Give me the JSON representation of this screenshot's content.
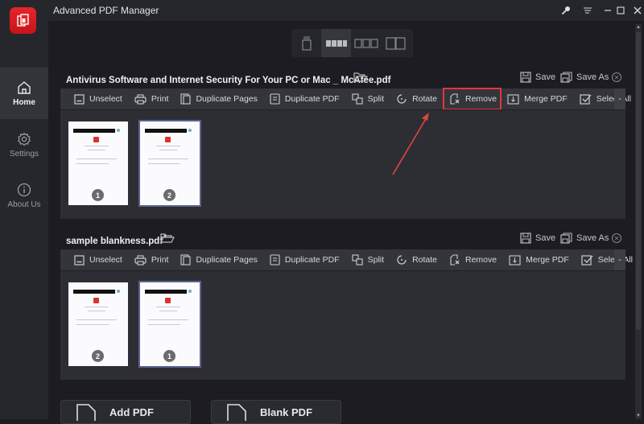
{
  "app": {
    "title": "Advanced PDF Manager",
    "accent_color": "#e5252a",
    "highlight_color": "#e5353a"
  },
  "window_controls": [
    {
      "name": "key-icon",
      "label": "Register"
    },
    {
      "name": "menu-icon",
      "label": "Menu"
    },
    {
      "name": "minimize-icon",
      "label": "Minimize"
    },
    {
      "name": "maximize-icon",
      "label": "Maximize"
    },
    {
      "name": "close-icon",
      "label": "Close"
    }
  ],
  "sidebar": {
    "items": [
      {
        "label": "Home",
        "icon": "home-icon",
        "active": true
      },
      {
        "label": "Settings",
        "icon": "gear-icon",
        "active": false
      },
      {
        "label": "About Us",
        "icon": "info-icon",
        "active": false
      }
    ]
  },
  "view_modes": [
    {
      "name": "single-page-view",
      "active": false
    },
    {
      "name": "four-column-view",
      "active": true
    },
    {
      "name": "three-column-view",
      "active": false
    },
    {
      "name": "two-column-view",
      "active": false
    }
  ],
  "header_actions": {
    "save": "Save",
    "save_as": "Save As"
  },
  "toolbar": {
    "unselect": "Unselect",
    "print": "Print",
    "duplicate_pages": "Duplicate Pages",
    "duplicate_pdf": "Duplicate PDF",
    "split": "Split",
    "rotate": "Rotate",
    "remove": "Remove",
    "merge_pdf": "Merge PDF",
    "select_all": "Select All",
    "more": "-"
  },
  "documents": [
    {
      "name": "Antivirus Software and Internet Security For Your PC or Mac _ McAfee.pdf",
      "modified_marker": "",
      "pages": [
        {
          "number": "1",
          "selected": false
        },
        {
          "number": "2",
          "selected": true
        }
      ],
      "remove_highlighted": true
    },
    {
      "name": "sample blankness.pdf",
      "modified_marker": "*",
      "pages": [
        {
          "number": "2",
          "selected": false
        },
        {
          "number": "1",
          "selected": true
        }
      ],
      "remove_highlighted": false
    }
  ],
  "bottom_buttons": {
    "add_pdf": "Add PDF",
    "blank_pdf": "Blank PDF"
  }
}
